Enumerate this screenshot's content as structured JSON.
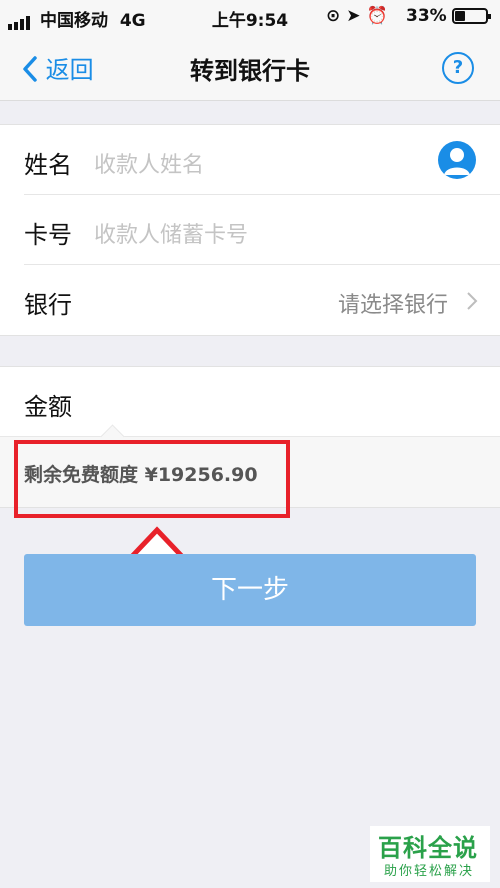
{
  "status_bar": {
    "carrier": "中国移动",
    "network": "4G",
    "time": "上午9:54",
    "battery_percent": "33%",
    "battery_level": 0.33
  },
  "nav": {
    "back_label": "返回",
    "title": "转到银行卡",
    "help_label": "?"
  },
  "form": {
    "name_label": "姓名",
    "name_placeholder": "收款人姓名",
    "card_label": "卡号",
    "card_placeholder": "收款人储蓄卡号",
    "bank_label": "银行",
    "bank_value": "请选择银行"
  },
  "amount": {
    "label": "金额",
    "free_quota_text": "剩余免费额度 ¥19256.90"
  },
  "actions": {
    "next_label": "下一步"
  },
  "watermark": {
    "title": "百科全说",
    "subtitle": "助你轻松解决"
  },
  "colors": {
    "accent": "#1a8de6",
    "button_disabled": "#7fb6e8",
    "annotation": "#e8212a",
    "watermark": "#2aa14a"
  }
}
